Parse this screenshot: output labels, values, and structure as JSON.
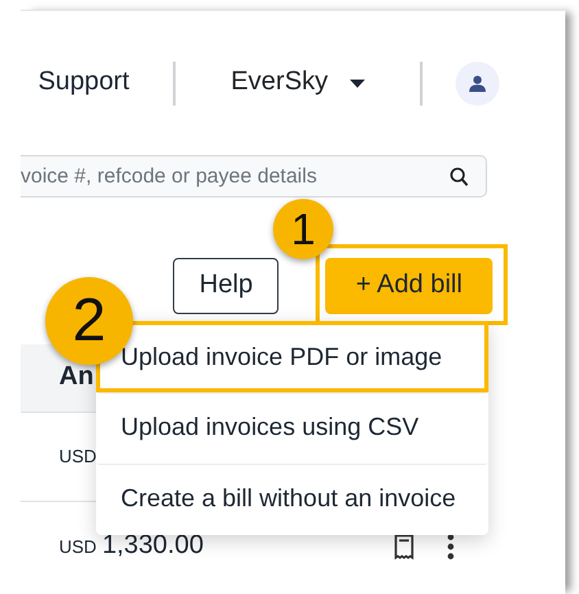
{
  "nav": {
    "links": [
      {
        "label": "Support"
      }
    ],
    "org": {
      "label": "EverSky"
    }
  },
  "search": {
    "placeholder": "voice #, refcode or payee details"
  },
  "buttons": [
    {
      "label": "Help",
      "kind": "outline",
      "highlighted": false
    },
    {
      "label": "+ Add bill",
      "kind": "primary",
      "highlighted": true
    }
  ],
  "menu": [
    {
      "label": "Upload invoice PDF or image",
      "highlighted": true
    },
    {
      "label": "Upload invoices using CSV",
      "highlighted": false
    },
    {
      "label": "Create a bill without an invoice",
      "highlighted": false
    }
  ],
  "table": {
    "columns": [
      "An"
    ],
    "rows": [
      {
        "currency": "USD"
      },
      {
        "currency": "USD",
        "amount": "1,330.00",
        "actions": true
      }
    ]
  },
  "callouts": [
    {
      "number": "1"
    },
    {
      "number": "2"
    }
  ]
}
